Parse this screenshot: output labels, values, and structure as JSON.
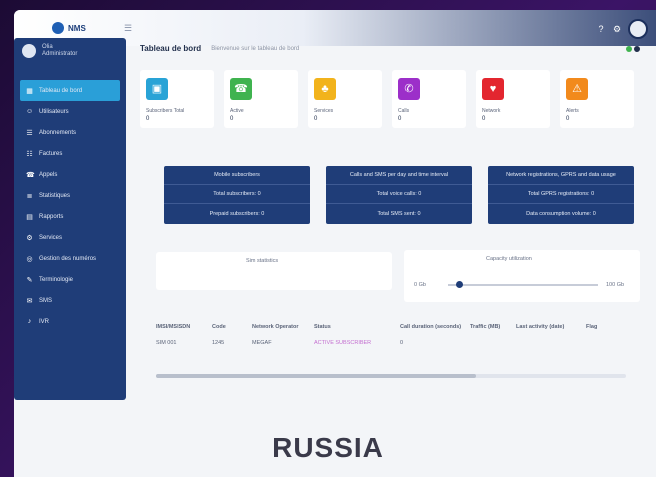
{
  "header": {
    "logo_text": "NMS"
  },
  "user": {
    "name": "Olia",
    "role": "Administrator"
  },
  "sidebar": {
    "items": [
      {
        "label": "Tableau de bord",
        "icon": "dashboard-icon",
        "glyph": "▦",
        "active": true
      },
      {
        "label": "Utilisateurs",
        "icon": "user-icon",
        "glyph": "☺"
      },
      {
        "label": "Abonnements",
        "icon": "subscription-icon",
        "glyph": "☰"
      },
      {
        "label": "Factures",
        "icon": "invoice-icon",
        "glyph": "☷"
      },
      {
        "label": "Appels",
        "icon": "phone-icon",
        "glyph": "☎"
      },
      {
        "label": "Statistiques",
        "icon": "stats-icon",
        "glyph": "≣"
      },
      {
        "label": "Rapports",
        "icon": "report-icon",
        "glyph": "▤"
      },
      {
        "label": "Services",
        "icon": "service-icon",
        "glyph": "⚙"
      },
      {
        "label": "Gestion des numéros",
        "icon": "numbers-icon",
        "glyph": "◎"
      },
      {
        "label": "Terminologie",
        "icon": "terms-icon",
        "glyph": "✎"
      },
      {
        "label": "SMS",
        "icon": "sms-icon",
        "glyph": "✉"
      },
      {
        "label": "IVR",
        "icon": "ivr-icon",
        "glyph": "♪"
      }
    ]
  },
  "page": {
    "title": "Tableau de bord",
    "subtitle": "Bienvenue sur le tableau de bord"
  },
  "tiles": [
    {
      "label": "Subscribers Total",
      "value": "0",
      "color": "#29a3d6",
      "glyph": "▣",
      "icon": "subscribers-icon"
    },
    {
      "label": "Active",
      "value": "0",
      "color": "#3fb34f",
      "glyph": "☎",
      "icon": "call-icon"
    },
    {
      "label": "Services",
      "value": "0",
      "color": "#f2b31c",
      "glyph": "♣",
      "icon": "group-icon"
    },
    {
      "label": "Calls",
      "value": "0",
      "color": "#9c2fc9",
      "glyph": "✆",
      "icon": "phone-out-icon"
    },
    {
      "label": "Network",
      "value": "0",
      "color": "#e3262f",
      "glyph": "♥",
      "icon": "wifi-icon"
    },
    {
      "label": "Alerts",
      "value": "0",
      "color": "#f28a1c",
      "glyph": "⚠",
      "icon": "alert-icon"
    }
  ],
  "groups": [
    {
      "rows": [
        "Mobile subscribers",
        "Total subscribers: 0",
        "Prepaid subscribers: 0"
      ]
    },
    {
      "rows": [
        "Calls and SMS per day and time interval",
        "Total voice calls: 0",
        "Total SMS sent: 0"
      ]
    },
    {
      "rows": [
        "Network registrations, GPRS and data usage",
        "Total GPRS registrations: 0",
        "Data consumption volume: 0"
      ]
    }
  ],
  "panels": {
    "left_title": "Sim statistics",
    "right_title": "Capacity utilization",
    "slider_left": "0 Gb",
    "slider_right": "100 Gb",
    "slider_fraction": 0.05
  },
  "table": {
    "headers": [
      "IMSI/MSISDN",
      "Code",
      "Network Operator",
      "Status",
      "Call duration (seconds)",
      "Traffic (MB)",
      "Last activity (date)",
      "Flag"
    ],
    "rows": [
      [
        "SIM 001",
        "1245",
        "MEGAF",
        "ACTIVE SUBSCRIBER",
        "0",
        "",
        "",
        ""
      ]
    ]
  },
  "caption": "RUSSIA",
  "colors": {
    "sidebar": "#1f3d78",
    "accent": "#2a9fd8",
    "status_active": "#c46fd0"
  }
}
